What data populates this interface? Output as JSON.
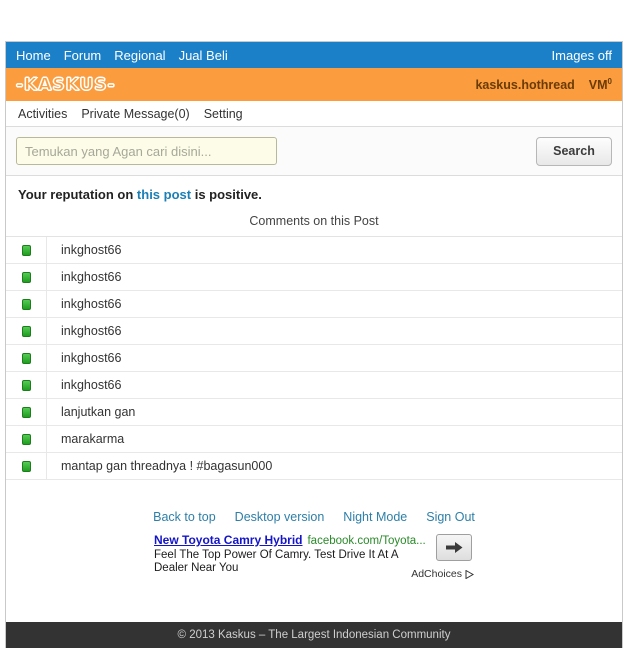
{
  "topbar": {
    "links": [
      {
        "label": "Home",
        "name": "nav-home"
      },
      {
        "label": "Forum",
        "name": "nav-forum"
      },
      {
        "label": "Regional",
        "name": "nav-regional"
      },
      {
        "label": "Jual Beli",
        "name": "nav-jual-beli"
      }
    ],
    "images_off": "Images off",
    "bg_color": "#1b80c8"
  },
  "logobar": {
    "logo_text": "-KASKUS-",
    "account": "kaskus.hothread",
    "vm_label": "VM",
    "vm_count": "0",
    "bg_color": "#fb9d3e"
  },
  "subnav": {
    "items": [
      {
        "label": "Activities",
        "name": "subnav-activities"
      },
      {
        "label": "Private Message(0)",
        "name": "subnav-private-message"
      },
      {
        "label": "Setting",
        "name": "subnav-setting"
      }
    ]
  },
  "search": {
    "placeholder": "Temukan yang Agan cari disini...",
    "value": "",
    "button_label": "Search"
  },
  "notice": {
    "prefix": "Your reputation on ",
    "link": "this post",
    "suffix": " is positive.",
    "link_color": "#1b7fb5"
  },
  "comments": {
    "header": "Comments on this Post",
    "icon_color": "#2eb82e",
    "rows": [
      {
        "icon": "green-square-icon",
        "text": "inkghost66"
      },
      {
        "icon": "green-square-icon",
        "text": "inkghost66"
      },
      {
        "icon": "green-square-icon",
        "text": "inkghost66"
      },
      {
        "icon": "green-square-icon",
        "text": "inkghost66"
      },
      {
        "icon": "green-square-icon",
        "text": "inkghost66"
      },
      {
        "icon": "green-square-icon",
        "text": "inkghost66"
      },
      {
        "icon": "green-square-icon",
        "text": "lanjutkan gan"
      },
      {
        "icon": "green-square-icon",
        "text": "marakarma"
      },
      {
        "icon": "green-square-icon",
        "text": "mantap gan threadnya ! #bagasun000"
      }
    ]
  },
  "footer": {
    "links": [
      {
        "label": "Back to top",
        "name": "footer-back-to-top"
      },
      {
        "label": "Desktop version",
        "name": "footer-desktop-version"
      },
      {
        "label": "Night Mode",
        "name": "footer-night-mode"
      },
      {
        "label": "Sign Out",
        "name": "footer-sign-out"
      }
    ],
    "copyright": "© 2013 Kaskus – The Largest Indonesian Community"
  },
  "ad": {
    "title": "New Toyota Camry Hybrid",
    "url": "facebook.com/Toyota...",
    "description": "Feel The Top Power Of Camry. Test Drive It At A Dealer Near You",
    "adchoices_label": "AdChoices",
    "arrow_glyph": "➡"
  }
}
